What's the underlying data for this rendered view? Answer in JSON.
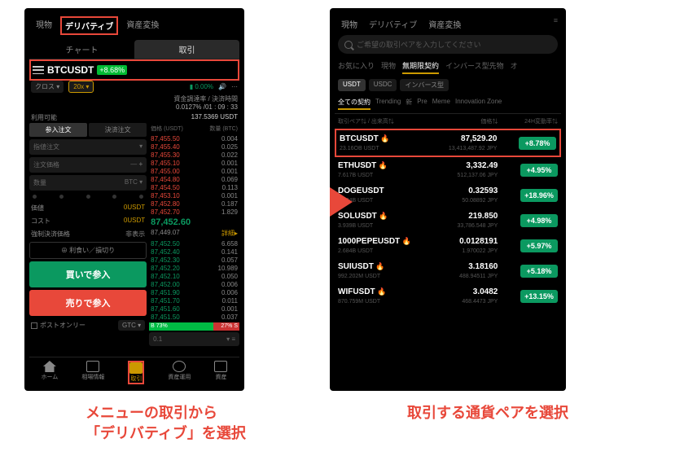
{
  "left": {
    "topTabs": {
      "spot": "現物",
      "deriv": "デリバティブ",
      "convert": "資産変換"
    },
    "subTabs": {
      "chart": "チャート",
      "trade": "取引"
    },
    "pair": "BTCUSDT",
    "pairChange": "+8.68%",
    "fundingLabel": "0.00%",
    "cross": "クロス",
    "leverage": "20x",
    "fundingRateLabel": "資金調達率 / 決済時間",
    "fundingCountdown": "0.0127% /01 : 09 : 33",
    "available": "利用可能",
    "availableValue": "137.5369 USDT",
    "modes": {
      "entry": "参入注文",
      "exit": "決済注文"
    },
    "limitType": "指値注文",
    "priceLabel": "注文価格",
    "qtyLabel": "数量",
    "qtyUnit": "BTC",
    "valueLabel": "価値",
    "valueV": "0USDT",
    "costLabel": "コスト",
    "costV": "0USDT",
    "liqLabel": "強制決済価格",
    "liqV": "非表示",
    "tpsl": "⊕ 利食い／損切り",
    "buy": "買いで参入",
    "sell": "売りで参入",
    "postOnly": "ポストオンリー",
    "gtc": "GTC",
    "obHead": {
      "price": "価格\n(USDT)",
      "qty": "数量\n(BTC)"
    },
    "asks": [
      [
        "87,455.50",
        "0.004"
      ],
      [
        "87,455.40",
        "0.025"
      ],
      [
        "87,455.30",
        "0.022"
      ],
      [
        "87,455.10",
        "0.001"
      ],
      [
        "87,455.00",
        "0.001"
      ],
      [
        "87,454.80",
        "0.069"
      ],
      [
        "87,454.50",
        "0.113"
      ],
      [
        "87,453.10",
        "0.001"
      ],
      [
        "87,452.80",
        "0.187"
      ],
      [
        "87,452.70",
        "1.829"
      ]
    ],
    "mid": "87,452.60",
    "midSub": "87,449.07",
    "midDetail": "詳細",
    "bids": [
      [
        "87,452.50",
        "6.658"
      ],
      [
        "87,452.40",
        "0.141"
      ],
      [
        "87,452.30",
        "0.057"
      ],
      [
        "87,452.20",
        "10.989"
      ],
      [
        "87,452.10",
        "0.050"
      ],
      [
        "87,452.00",
        "0.006"
      ],
      [
        "87,451.90",
        "0.006"
      ],
      [
        "87,451.70",
        "0.011"
      ],
      [
        "87,451.60",
        "0.001"
      ],
      [
        "87,451.50",
        "0.037"
      ]
    ],
    "depthB": "73%",
    "depthA": "27%",
    "obStep": "0.1",
    "nav": {
      "home": "ホーム",
      "market": "相場情報",
      "trade": "取引",
      "earn": "資産運用",
      "assets": "資産"
    }
  },
  "right": {
    "topTabs": {
      "spot": "現物",
      "deriv": "デリバティブ",
      "convert": "資産変換"
    },
    "searchPlaceholder": "ご希望の取引ペアを入力してください",
    "cats": [
      "お気に入り",
      "現物",
      "無期限契約",
      "インバース型先物",
      "オ"
    ],
    "catActive": "無期限契約",
    "pills": [
      "USDT",
      "USDC",
      "インバース型"
    ],
    "cats2": [
      "全ての契約",
      "Trending",
      "新",
      "Pre",
      "Meme",
      "Innovation Zone"
    ],
    "cats2Active": "全ての契約",
    "listHead": {
      "c1": "取引ペア⇅ / 出来高⇅",
      "c2": "価格⇅",
      "c3": "24H変動率⇅"
    },
    "rows": [
      {
        "sym": "BTCUSDT",
        "fire": true,
        "vol": "23.16OB USDT",
        "price": "87,529.20",
        "sub": "13,413,487.92 JPY",
        "chg": "+8.78%",
        "box": true
      },
      {
        "sym": "ETHUSDT",
        "fire": true,
        "vol": "7.617B USDT",
        "price": "3,332.49",
        "sub": "512,137.06 JPY",
        "chg": "+4.95%"
      },
      {
        "sym": "DOGEUSDT",
        "fire": false,
        "vol": "5.004B USDT",
        "price": "0.32593",
        "sub": "50.08892 JPY",
        "chg": "+18.96%"
      },
      {
        "sym": "SOLUSDT",
        "fire": true,
        "vol": "3.939B USDT",
        "price": "219.850",
        "sub": "33,786.548 JPY",
        "chg": "+4.98%"
      },
      {
        "sym": "1000PEPEUSDT",
        "fire": true,
        "vol": "2.684B USDT",
        "price": "0.0128191",
        "sub": "1.970022 JPY",
        "chg": "+5.97%"
      },
      {
        "sym": "SUIUSDT",
        "fire": true,
        "vol": "992.202M USDT",
        "price": "3.18160",
        "sub": "488.94511 JPY",
        "chg": "+5.18%"
      },
      {
        "sym": "WIFUSDT",
        "fire": true,
        "vol": "870.759M USDT",
        "price": "3.0482",
        "sub": "468.4473 JPY",
        "chg": "+13.15%"
      }
    ]
  },
  "captions": {
    "left": "メニューの取引から\n「デリバティブ」を選択",
    "right": "取引する通貨ペアを選択"
  }
}
